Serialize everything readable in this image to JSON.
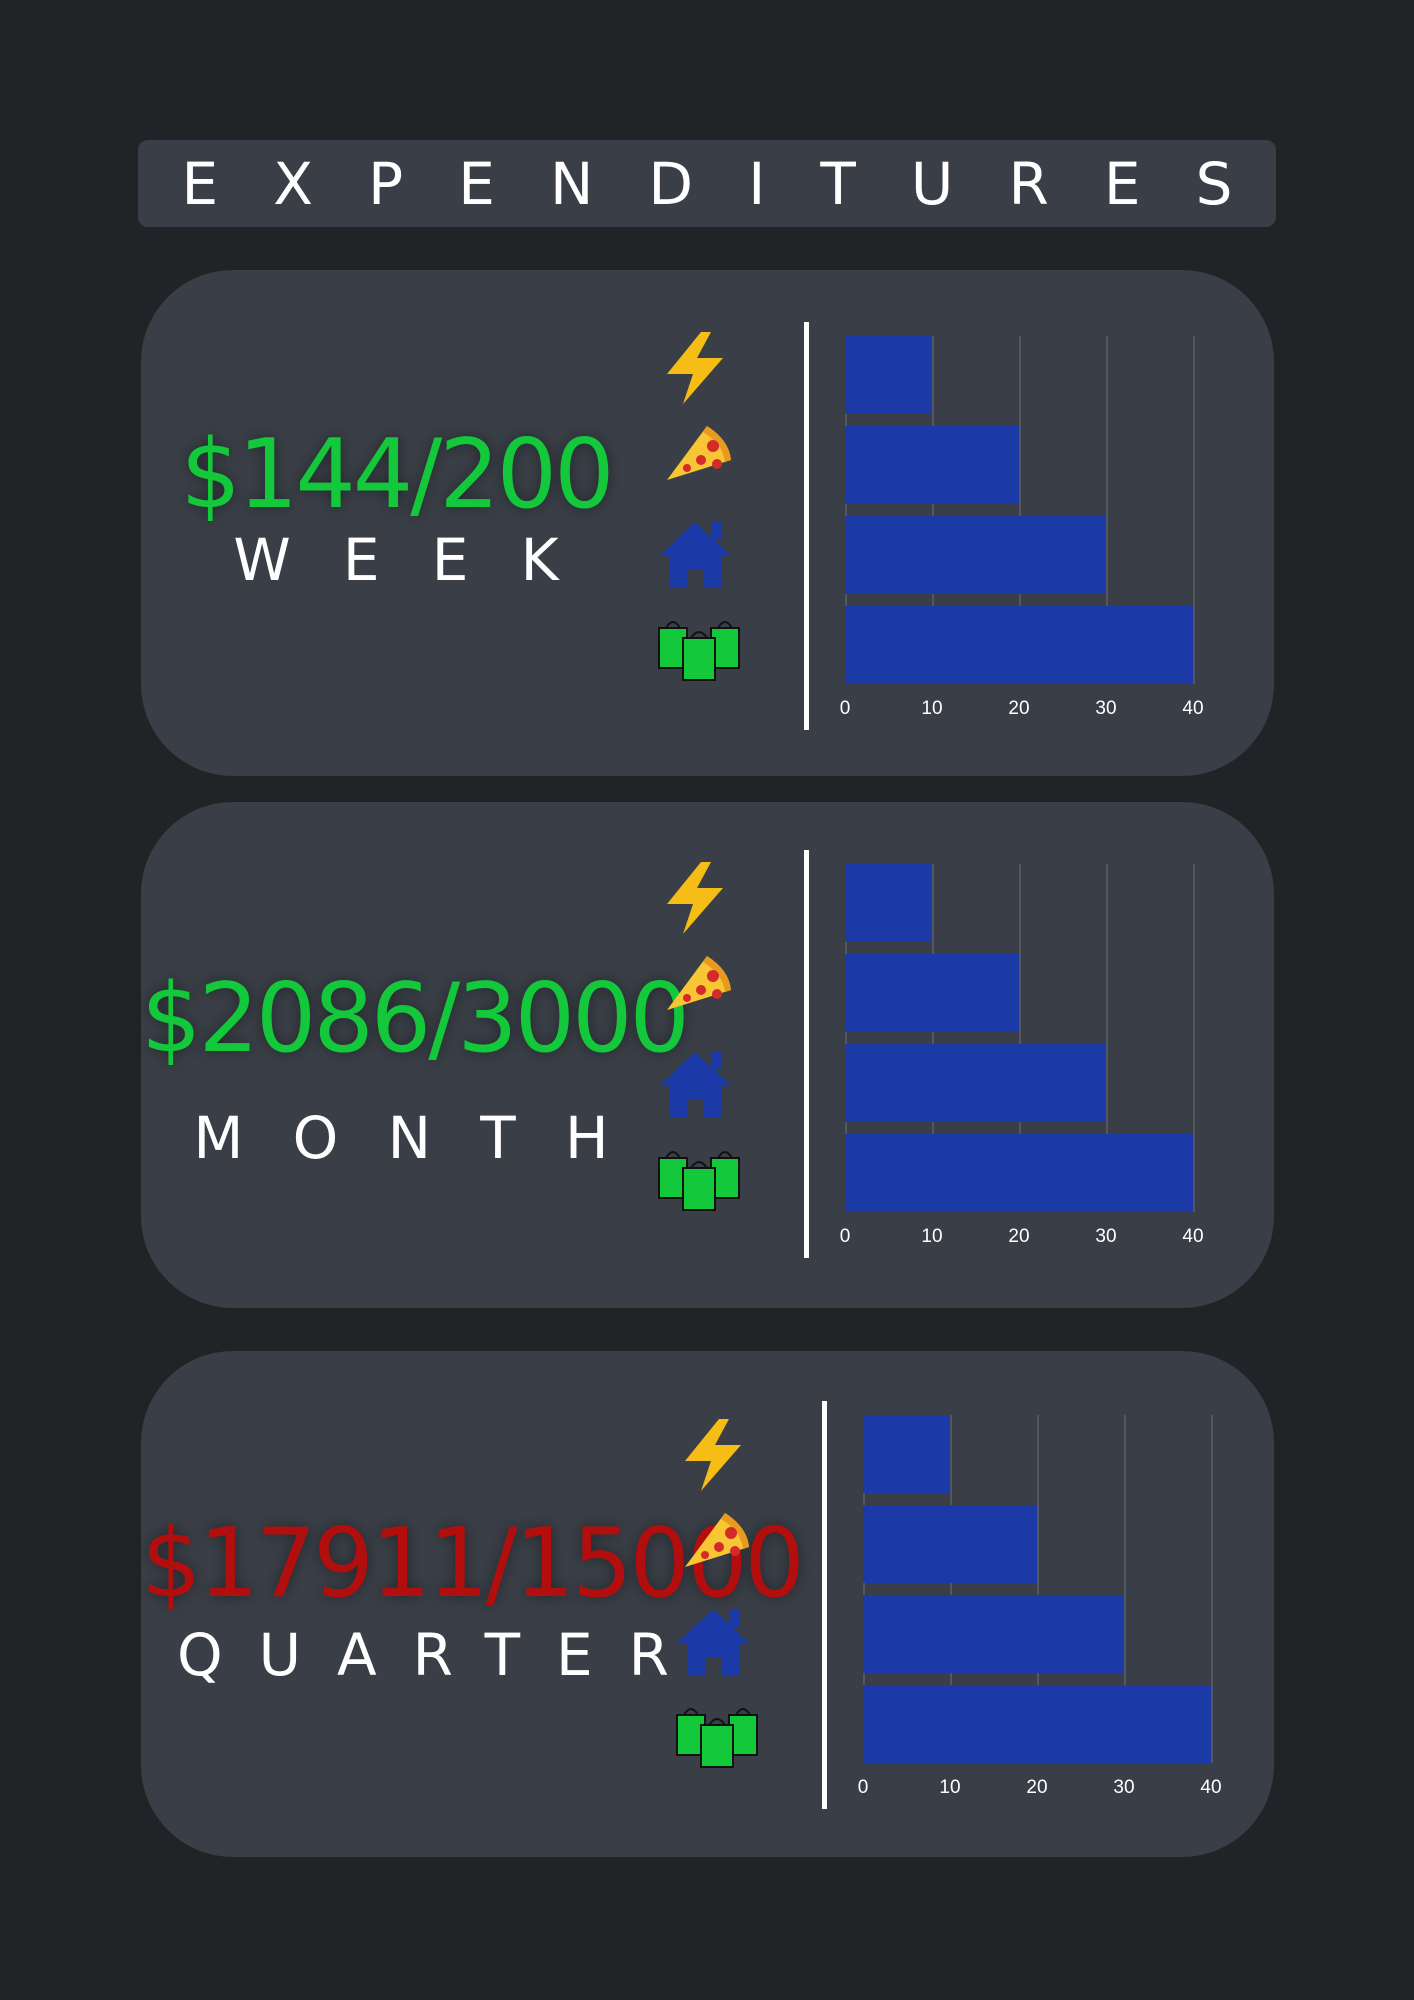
{
  "title": "EXPENDITURES",
  "colors": {
    "background": "#212327",
    "card": "#3a3f47",
    "bar": "#1b3aa8",
    "under_budget": "#13c83a",
    "over_budget": "#b30e0e",
    "bolt": "#f6bd16",
    "house": "#1b3aa8",
    "bags": "#13c83a"
  },
  "icons": [
    "lightning-bolt-icon",
    "pizza-icon",
    "house-icon",
    "shopping-bags-icon"
  ],
  "panels": [
    {
      "amount": "$144/200",
      "period": "WEEK",
      "status": "under_budget"
    },
    {
      "amount": "$2086/3000",
      "period": "MONTH",
      "status": "under_budget"
    },
    {
      "amount": "$17911/15000",
      "period": "QUARTER",
      "status": "over_budget"
    }
  ],
  "chart_data": [
    {
      "type": "bar",
      "orientation": "horizontal",
      "categories": [
        "lightning-bolt-icon",
        "pizza-icon",
        "house-icon",
        "shopping-bags-icon"
      ],
      "values": [
        10,
        20,
        30,
        40
      ],
      "xlim": [
        0,
        40
      ],
      "xticks": [
        "0",
        "10",
        "20",
        "30",
        "40"
      ],
      "grid": true
    },
    {
      "type": "bar",
      "orientation": "horizontal",
      "categories": [
        "lightning-bolt-icon",
        "pizza-icon",
        "house-icon",
        "shopping-bags-icon"
      ],
      "values": [
        10,
        20,
        30,
        40
      ],
      "xlim": [
        0,
        40
      ],
      "xticks": [
        "0",
        "10",
        "20",
        "30",
        "40"
      ],
      "grid": true
    },
    {
      "type": "bar",
      "orientation": "horizontal",
      "categories": [
        "lightning-bolt-icon",
        "pizza-icon",
        "house-icon",
        "shopping-bags-icon"
      ],
      "values": [
        10,
        20,
        30,
        40
      ],
      "xlim": [
        0,
        40
      ],
      "xticks": [
        "0",
        "10",
        "20",
        "30",
        "40"
      ],
      "grid": true
    }
  ]
}
